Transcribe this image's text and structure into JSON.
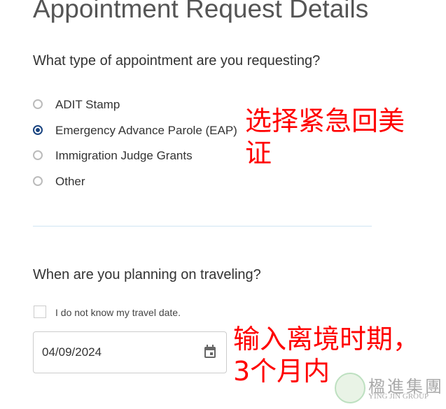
{
  "title": "Appointment Request Details",
  "q1": "What type of appointment are you requesting?",
  "options": [
    {
      "label": "ADIT Stamp",
      "selected": false
    },
    {
      "label": "Emergency Advance Parole (EAP)",
      "selected": true
    },
    {
      "label": "Immigration Judge Grants",
      "selected": false
    },
    {
      "label": "Other",
      "selected": false
    }
  ],
  "note1": "选择紧急回美证",
  "q2": "When are you planning on traveling?",
  "unknown_date_label": "I do not know my travel date.",
  "unknown_date_checked": false,
  "date_value": "04/09/2024",
  "note2": "输入离境时期，3个月内",
  "watermark": {
    "cn": "楹進集團",
    "en": "YING JIN GROUP"
  },
  "colors": {
    "accent": "#1a4480",
    "annotation": "#ff0000"
  }
}
